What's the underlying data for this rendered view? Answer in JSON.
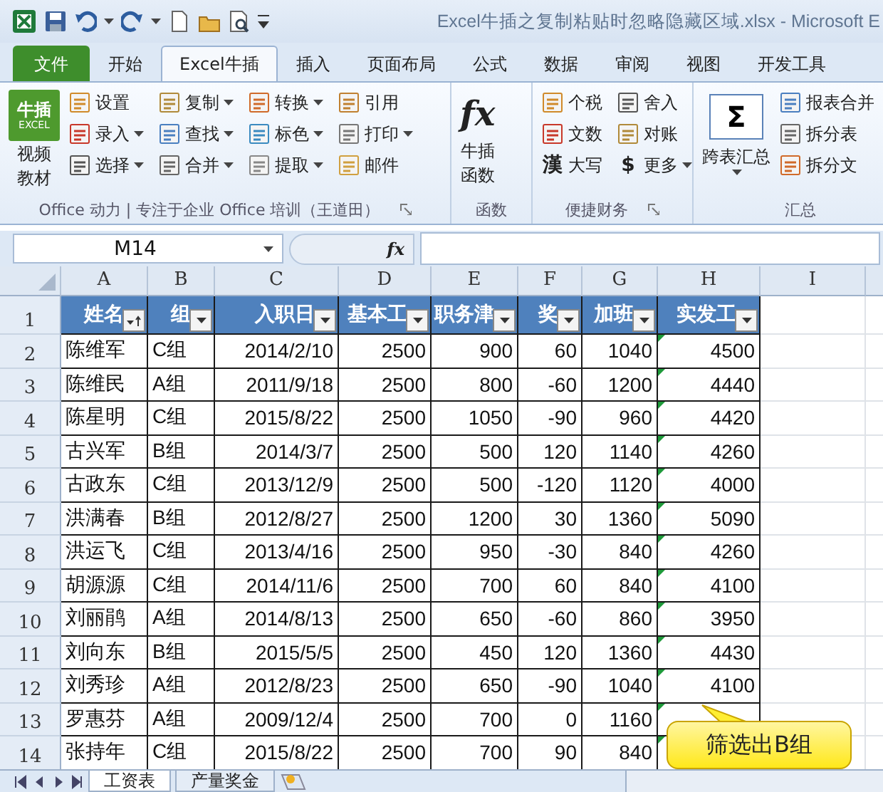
{
  "window": {
    "title": "Excel牛插之复制粘贴时忽略隐藏区域.xlsx  -  Microsoft E"
  },
  "tabs": [
    {
      "label": "文件",
      "kind": "file",
      "selected": false
    },
    {
      "label": "开始",
      "kind": "tab",
      "selected": false
    },
    {
      "label": "Excel牛插",
      "kind": "tab",
      "selected": true
    },
    {
      "label": "插入",
      "kind": "tab",
      "selected": false
    },
    {
      "label": "页面布局",
      "kind": "tab",
      "selected": false
    },
    {
      "label": "公式",
      "kind": "tab",
      "selected": false
    },
    {
      "label": "数据",
      "kind": "tab",
      "selected": false
    },
    {
      "label": "审阅",
      "kind": "tab",
      "selected": false
    },
    {
      "label": "视图",
      "kind": "tab",
      "selected": false
    },
    {
      "label": "开发工具",
      "kind": "tab",
      "selected": false
    }
  ],
  "ribbon": {
    "groups": [
      {
        "label": "Office 动力 | 专注于企业 Office 培训（王道田）",
        "launcher": true,
        "items": [
          {
            "kind": "large",
            "lines": [
              "视频",
              "教材"
            ],
            "badge": [
              "牛插",
              "EXCEL"
            ],
            "dropdown": false
          },
          {
            "kind": "column",
            "buttons": [
              {
                "label": "设置",
                "dropdown": false
              },
              {
                "label": "录入",
                "dropdown": true
              },
              {
                "label": "选择",
                "dropdown": true
              }
            ]
          },
          {
            "kind": "column",
            "buttons": [
              {
                "label": "复制",
                "dropdown": true
              },
              {
                "label": "查找",
                "dropdown": true
              },
              {
                "label": "合并",
                "dropdown": true
              }
            ]
          },
          {
            "kind": "column",
            "buttons": [
              {
                "label": "转换",
                "dropdown": true
              },
              {
                "label": "标色",
                "dropdown": true
              },
              {
                "label": "提取",
                "dropdown": true
              }
            ]
          },
          {
            "kind": "column",
            "buttons": [
              {
                "label": "引用",
                "dropdown": false
              },
              {
                "label": "打印",
                "dropdown": true
              },
              {
                "label": "邮件",
                "dropdown": false
              }
            ]
          }
        ]
      },
      {
        "label": "函数",
        "launcher": false,
        "items": [
          {
            "kind": "large",
            "lines": [
              "牛插",
              "函数"
            ],
            "glyph": "fx",
            "dropdown": false
          }
        ]
      },
      {
        "label": "便捷财务",
        "launcher": true,
        "items": [
          {
            "kind": "column",
            "buttons": [
              {
                "label": "个税",
                "dropdown": false
              },
              {
                "label": "文数",
                "dropdown": false
              },
              {
                "label": "大写",
                "glyph": "漢",
                "dropdown": false
              }
            ]
          },
          {
            "kind": "column",
            "buttons": [
              {
                "label": "舍入",
                "dropdown": false
              },
              {
                "label": "对账",
                "dropdown": false
              },
              {
                "label": "更多",
                "glyph": "$",
                "dropdown": true
              }
            ]
          }
        ]
      },
      {
        "label": "汇总",
        "launcher": false,
        "items": [
          {
            "kind": "large",
            "lines": [
              "跨表汇总"
            ],
            "glyph": "Σ",
            "dropdown": true
          },
          {
            "kind": "column",
            "buttons": [
              {
                "label": "报表合并",
                "dropdown": false
              },
              {
                "label": "拆分表",
                "dropdown": false
              },
              {
                "label": "拆分文",
                "dropdown": false
              }
            ]
          }
        ]
      }
    ]
  },
  "formula_bar": {
    "name_box": "M14",
    "fx": "fx"
  },
  "sheet": {
    "columns": [
      "A",
      "B",
      "C",
      "D",
      "E",
      "F",
      "G",
      "H",
      "I"
    ],
    "header_row": {
      "number": "1",
      "cells": [
        {
          "text": "姓名",
          "sorted": true
        },
        {
          "text": "组",
          "sorted": false
        },
        {
          "text": "入职日",
          "sorted": false
        },
        {
          "text": "基本工",
          "sorted": false
        },
        {
          "text": "职务津",
          "sorted": false
        },
        {
          "text": "奖",
          "sorted": false
        },
        {
          "text": "加班",
          "sorted": false
        },
        {
          "text": "实发工",
          "sorted": false
        }
      ]
    },
    "rows": [
      {
        "number": "2",
        "cells": [
          "陈维军",
          "C组",
          "2014/2/10",
          "2500",
          "900",
          "60",
          "1040",
          "4500"
        ],
        "error_flag": true
      },
      {
        "number": "3",
        "cells": [
          "陈维民",
          "A组",
          "2011/9/18",
          "2500",
          "800",
          "-60",
          "1200",
          "4440"
        ],
        "error_flag": true
      },
      {
        "number": "4",
        "cells": [
          "陈星明",
          "C组",
          "2015/8/22",
          "2500",
          "1050",
          "-90",
          "960",
          "4420"
        ],
        "error_flag": true
      },
      {
        "number": "5",
        "cells": [
          "古兴军",
          "B组",
          "2014/3/7",
          "2500",
          "500",
          "120",
          "1140",
          "4260"
        ],
        "error_flag": true
      },
      {
        "number": "6",
        "cells": [
          "古政东",
          "C组",
          "2013/12/9",
          "2500",
          "500",
          "-120",
          "1120",
          "4000"
        ],
        "error_flag": true
      },
      {
        "number": "7",
        "cells": [
          "洪满春",
          "B组",
          "2012/8/27",
          "2500",
          "1200",
          "30",
          "1360",
          "5090"
        ],
        "error_flag": true
      },
      {
        "number": "8",
        "cells": [
          "洪运飞",
          "C组",
          "2013/4/16",
          "2500",
          "950",
          "-30",
          "840",
          "4260"
        ],
        "error_flag": true
      },
      {
        "number": "9",
        "cells": [
          "胡源源",
          "C组",
          "2014/11/6",
          "2500",
          "700",
          "60",
          "840",
          "4100"
        ],
        "error_flag": true
      },
      {
        "number": "10",
        "cells": [
          "刘丽鹃",
          "A组",
          "2014/8/13",
          "2500",
          "650",
          "-60",
          "860",
          "3950"
        ],
        "error_flag": true
      },
      {
        "number": "11",
        "cells": [
          "刘向东",
          "B组",
          "2015/5/5",
          "2500",
          "450",
          "120",
          "1360",
          "4430"
        ],
        "error_flag": true
      },
      {
        "number": "12",
        "cells": [
          "刘秀珍",
          "A组",
          "2012/8/23",
          "2500",
          "650",
          "-90",
          "1040",
          "4100"
        ],
        "error_flag": true
      },
      {
        "number": "13",
        "cells": [
          "罗惠芬",
          "A组",
          "2009/12/4",
          "2500",
          "700",
          "0",
          "1160"
        ],
        "error_flag": true
      },
      {
        "number": "14",
        "cells": [
          "张持年",
          "C组",
          "2015/8/22",
          "2500",
          "700",
          "90",
          "840"
        ],
        "error_flag": true
      }
    ]
  },
  "callout": {
    "text": "筛选出B组"
  },
  "sheet_tabs": [
    {
      "label": "工资表",
      "selected": true
    },
    {
      "label": "产量奖金",
      "selected": false
    }
  ]
}
